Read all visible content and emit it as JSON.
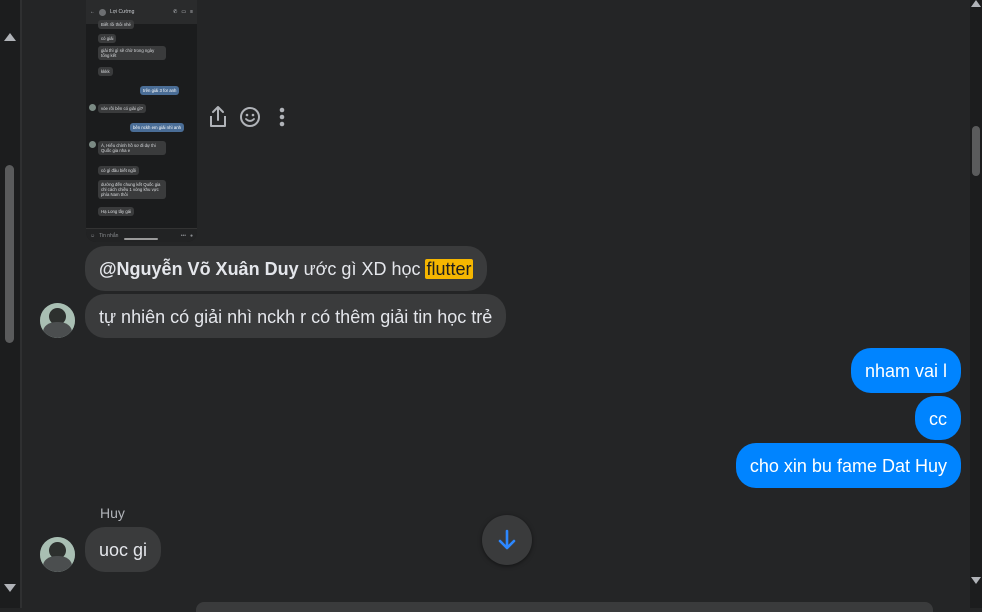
{
  "screenshot_preview": {
    "title": "Lợi Cường",
    "messages": [
      {
        "from": "them",
        "text": "Biết rồi thôi nhé"
      },
      {
        "from": "them",
        "text": "có giải"
      },
      {
        "from": "them",
        "text": "giải thì gì sẽ chờ trong ngày tổng kết"
      },
      {
        "from": "them",
        "text": "kkkk"
      },
      {
        "from": "me",
        "text": "trên giải 3 for anh"
      },
      {
        "from": "them",
        "text": "vòe rồi bên có giải gì?"
      },
      {
        "from": "me",
        "text": "bên nckh em giải nhì anh"
      },
      {
        "from": "them",
        "text": "À, Hiếu chính hồ sơ đi dự thi Quốc gia nha e"
      },
      {
        "from": "them",
        "text": "có gì đâu biết ngồi"
      },
      {
        "from": "them",
        "text": "dường đến chung kết Quốc gia chỉ cách chiều 1 vòng khu vực phía Nam thôi"
      },
      {
        "from": "them",
        "text": "Hạ Long tây gái"
      }
    ],
    "composer_placeholder": "Tin nhắn"
  },
  "messages": {
    "mention_name": "@Nguyễn Võ Xuân Duy",
    "mention_text": " ước gì XD học ",
    "highlight": "flutter",
    "msg2": "tự nhiên có giải nhì nckh r có thêm giải tin học trẻ",
    "out1": "nham vai l",
    "out2": "cc",
    "out3": "cho xin bu fame Dat Huy",
    "sender_name": "Huy",
    "msg3": "uoc gi"
  },
  "colors": {
    "background": "#242526",
    "incoming_bubble": "#3a3b3c",
    "outgoing_bubble": "#0084ff",
    "highlight": "#f5b600"
  }
}
